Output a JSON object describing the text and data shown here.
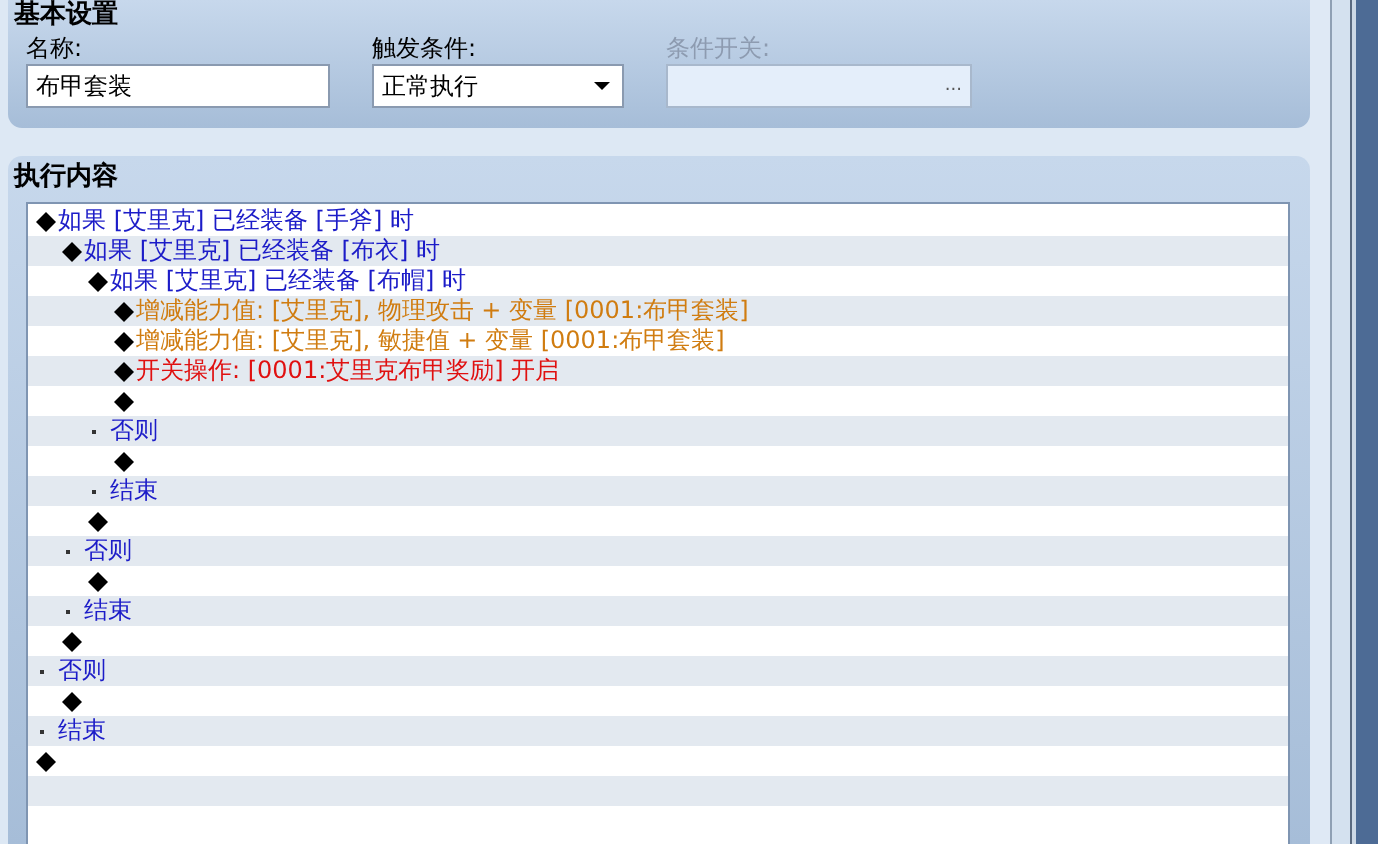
{
  "basic_settings": {
    "title": "基本设置",
    "name_field": {
      "label": "名称:",
      "value": "布甲套装"
    },
    "trigger_field": {
      "label": "触发条件:",
      "value": "正常执行"
    },
    "switch_field": {
      "label": "条件开关:",
      "button": "...",
      "disabled": true
    }
  },
  "content": {
    "title": "执行内容",
    "lines": [
      {
        "kind": "statement",
        "text": "如果 [艾里克] 已经装备 [手斧] 时",
        "color": "#1c1cc8",
        "children": [
          {
            "kind": "statement",
            "text": "如果 [艾里克] 已经装备 [布衣] 时",
            "color": "#1c1cc8",
            "children": [
              {
                "kind": "statement",
                "text": "如果 [艾里克] 已经装备 [布帽] 时",
                "color": "#1c1cc8",
                "children": [
                  {
                    "kind": "statement",
                    "text": "增减能力值: [艾里克], 物理攻击 + 变量 [0001:布甲套装]",
                    "color": "#d07c10"
                  },
                  {
                    "kind": "statement",
                    "text": "增减能力值: [艾里克], 敏捷值 + 变量 [0001:布甲套装]",
                    "color": "#d07c10"
                  },
                  {
                    "kind": "statement",
                    "text": "开关操作: [0001:艾里克布甲奖励] 开启",
                    "color": "#e01010"
                  },
                  {
                    "kind": "statement"
                  }
                ]
              },
              {
                "kind": "branch",
                "text": "否则",
                "color": "#1c1cc8",
                "children": [
                  {
                    "kind": "statement"
                  }
                ]
              },
              {
                "kind": "branch",
                "text": "结束",
                "color": "#1c1cc8"
              },
              {
                "kind": "statement"
              }
            ]
          },
          {
            "kind": "branch",
            "text": "否则",
            "color": "#1c1cc8",
            "children": [
              {
                "kind": "statement"
              }
            ]
          },
          {
            "kind": "branch",
            "text": "结束",
            "color": "#1c1cc8"
          },
          {
            "kind": "statement"
          }
        ]
      },
      {
        "kind": "branch",
        "text": "否则",
        "color": "#1c1cc8",
        "children": [
          {
            "kind": "statement"
          }
        ]
      },
      {
        "kind": "branch",
        "text": "结束",
        "color": "#1c1cc8"
      },
      {
        "kind": "statement"
      }
    ]
  }
}
